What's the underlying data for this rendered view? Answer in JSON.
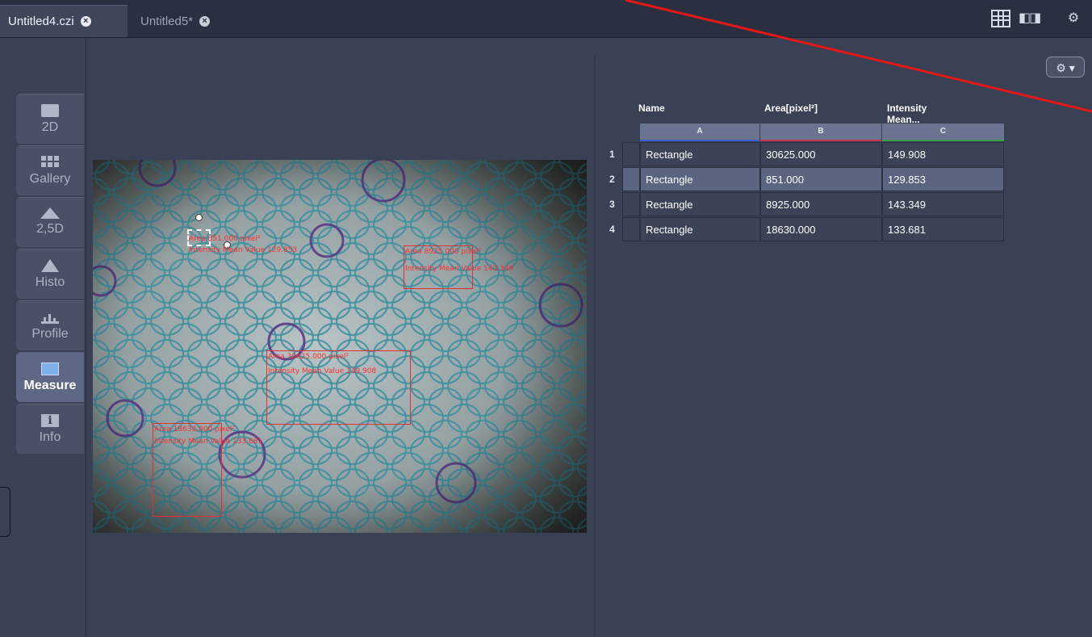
{
  "tabs": [
    {
      "label": "Untitled4.czi",
      "active": true
    },
    {
      "label": "Untitled5*",
      "active": false
    }
  ],
  "toolbar": {
    "icons": [
      "grid-layout-icon",
      "split-view-icon",
      "gear-icon"
    ]
  },
  "view_tabs": [
    {
      "label": "2D",
      "icon": "image-2d-icon"
    },
    {
      "label": "Gallery",
      "icon": "gallery-icon"
    },
    {
      "label": "2,5D",
      "icon": "surface-25d-icon"
    },
    {
      "label": "Histo",
      "icon": "histogram-icon"
    },
    {
      "label": "Profile",
      "icon": "profile-icon"
    },
    {
      "label": "Measure",
      "icon": "measure-icon",
      "active": true
    },
    {
      "label": "Info",
      "icon": "info-icon"
    }
  ],
  "image_annotations": [
    {
      "area": "Area 851.000 pixel²",
      "intensity": "Intensity Mean Value 129.853"
    },
    {
      "area": "Area 8925.000 pixel²",
      "intensity": "Intensity Mean Value 143.349"
    },
    {
      "area": "Area 30625.000 pixel²",
      "intensity": "Intensity Mean Value 149.908"
    },
    {
      "area": "Area 18630.000 pixel²",
      "intensity": "Intensity Mean Value 133.681"
    }
  ],
  "settings_button": {
    "label": "⚙ ▾"
  },
  "table": {
    "columns": [
      {
        "header": "Name",
        "letter": "A",
        "accent": "#3a5cc8"
      },
      {
        "header": "Area[pixel²]",
        "letter": "B",
        "accent": "#c8344a"
      },
      {
        "header": "Intensity Mean...",
        "letter": "C",
        "accent": "#3ca04a"
      }
    ],
    "rows": [
      {
        "num": "1",
        "name": "Rectangle",
        "area": "30625.000",
        "intensity": "149.908",
        "selected": false
      },
      {
        "num": "2",
        "name": "Rectangle",
        "area": "851.000",
        "intensity": "129.853",
        "selected": true
      },
      {
        "num": "3",
        "name": "Rectangle",
        "area": "8925.000",
        "intensity": "143.349",
        "selected": false
      },
      {
        "num": "4",
        "name": "Rectangle",
        "area": "18630.000",
        "intensity": "133.681",
        "selected": false
      }
    ]
  },
  "colors": {
    "roi": "#e63030",
    "background": "#3a4155",
    "selected_row": "#5c6580"
  }
}
